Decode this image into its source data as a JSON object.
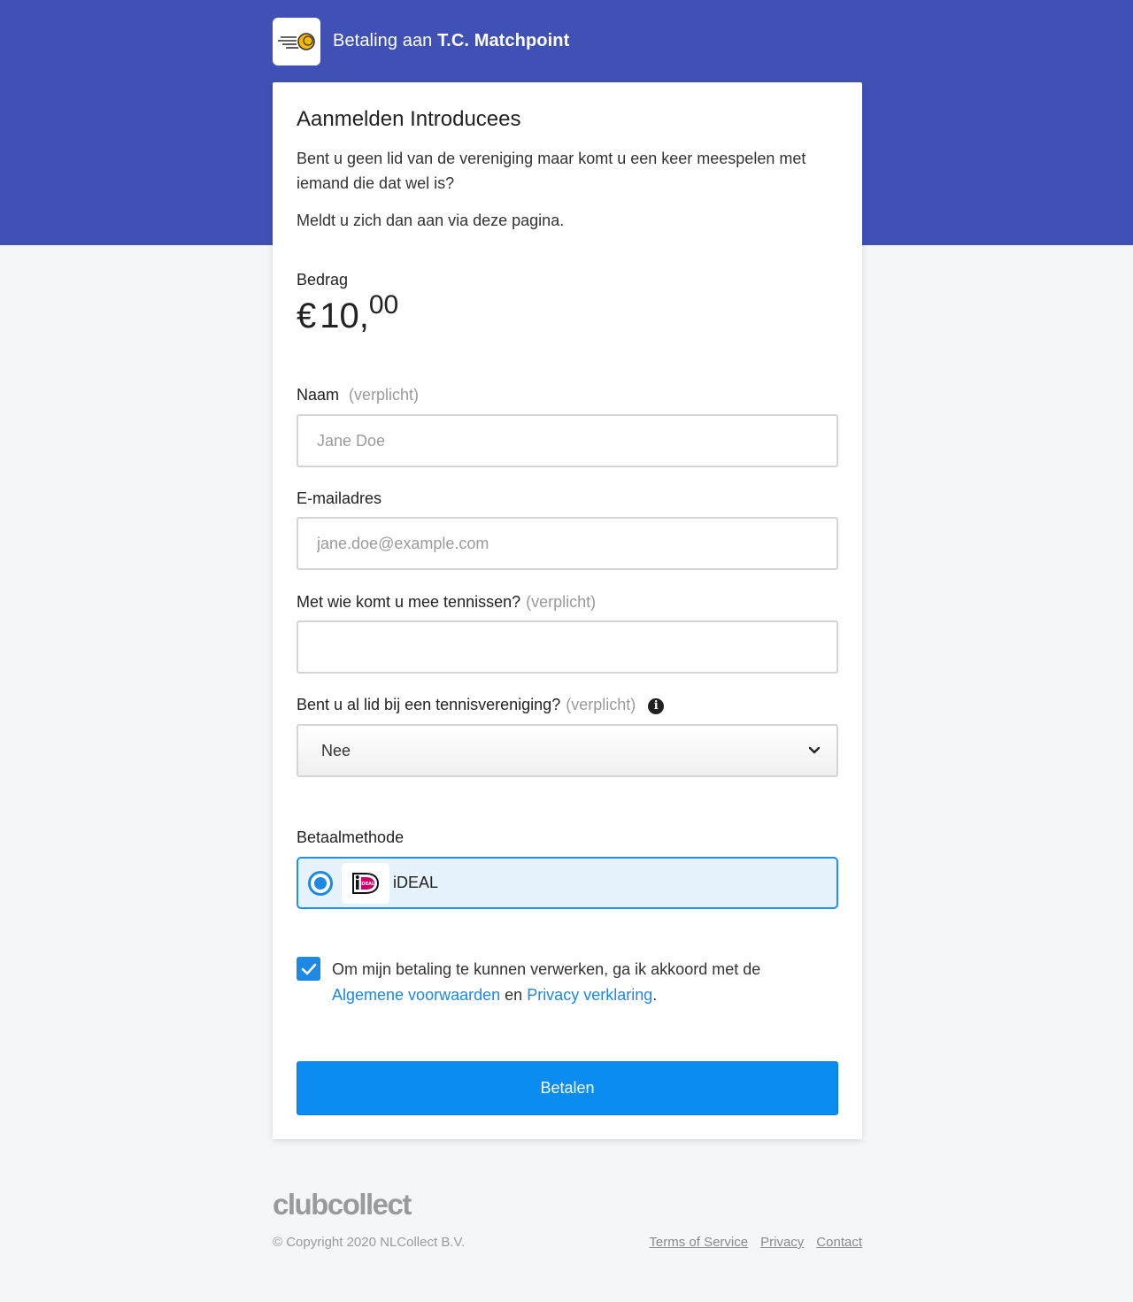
{
  "header": {
    "prefix": "Betaling aan",
    "club_name": "T.C. Matchpoint"
  },
  "card": {
    "title": "Aanmelden Introducees",
    "intro": "Bent u geen lid van de vereniging maar komt u een keer meespelen met iemand die dat wel is?",
    "intro2": "Meldt u zich dan aan via deze pagina."
  },
  "amount": {
    "label": "Bedrag",
    "currency": "€",
    "integer": "10,",
    "decimals": "00"
  },
  "form": {
    "required_tag": "(verplicht)",
    "name": {
      "label": "Naam",
      "placeholder": "Jane Doe",
      "value": ""
    },
    "email": {
      "label": "E-mailadres",
      "placeholder": "jane.doe@example.com",
      "value": ""
    },
    "partner": {
      "label": "Met wie komt u mee tennissen?",
      "value": ""
    },
    "member": {
      "label": "Bent u al lid bij een tennisvereniging?",
      "selected": "Nee"
    }
  },
  "payment": {
    "label": "Betaalmethode",
    "method": "iDEAL",
    "selected": true
  },
  "consent": {
    "checked": true,
    "text_before": "Om mijn betaling te kunnen verwerken, ga ik akkoord met de",
    "link_terms": "Algemene voorwaarden",
    "connector": "en",
    "link_privacy": "Privacy verklaring",
    "end": "."
  },
  "actions": {
    "pay_label": "Betalen"
  },
  "footer": {
    "brand": "clubcollect",
    "copyright": "© Copyright 2020 NLCollect B.V.",
    "links": [
      "Terms of Service",
      "Privacy",
      "Contact"
    ]
  },
  "colors": {
    "header_bg": "#3f51b5",
    "accent": "#1e88e5",
    "button": "#0a8cf0",
    "ideal_pink": "#cc0066"
  }
}
